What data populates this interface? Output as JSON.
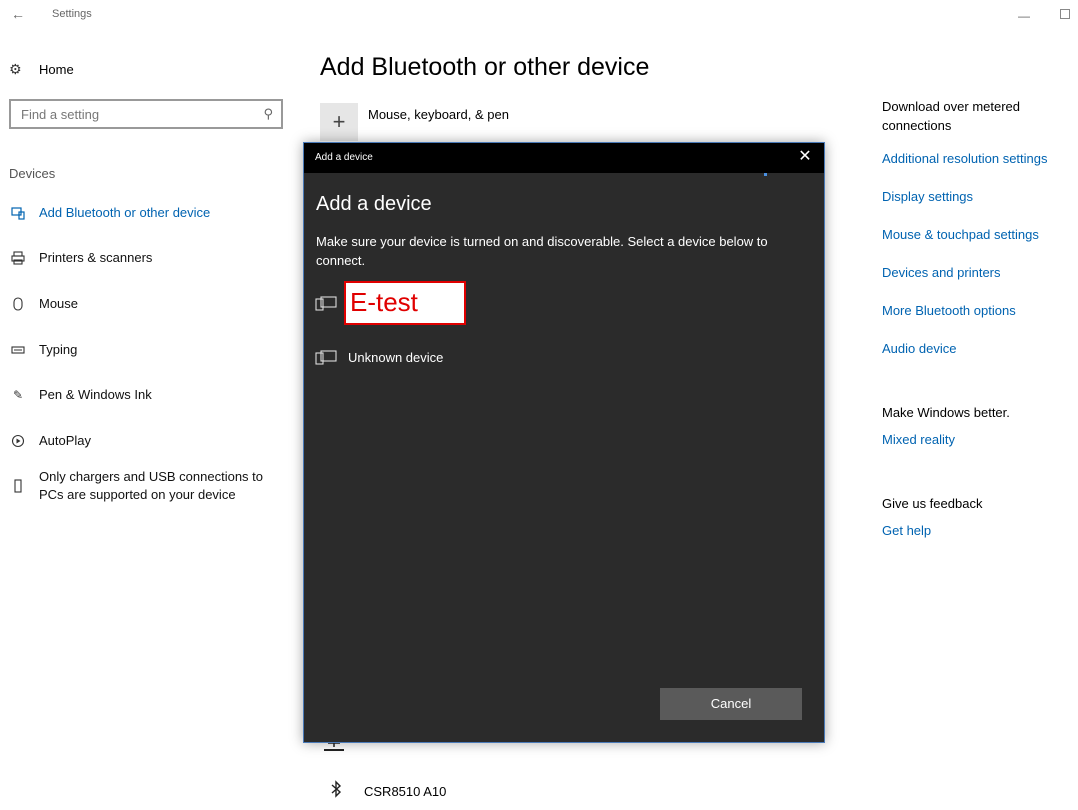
{
  "window": {
    "title": "Settings",
    "back_glyph": "←",
    "min_glyph": "—"
  },
  "sidebar": {
    "home_label": "Home",
    "search_placeholder": "Find a setting",
    "section_label": "Devices",
    "items": [
      {
        "label": "Add Bluetooth or other device",
        "icon": "bluetooth-devices-icon",
        "active": true
      },
      {
        "label": "Printers & scanners",
        "icon": "printer-icon",
        "active": false
      },
      {
        "label": "Mouse",
        "icon": "mouse-icon",
        "active": false
      },
      {
        "label": "Typing",
        "icon": "keyboard-icon",
        "active": false
      },
      {
        "label": "Pen & Windows Ink",
        "icon": "pen-icon",
        "active": false
      },
      {
        "label": "AutoPlay",
        "icon": "autoplay-icon",
        "active": false
      },
      {
        "label": "Only chargers and USB connections to PCs are supported on your device",
        "icon": "usb-icon",
        "active": false
      }
    ]
  },
  "main": {
    "title": "Add Bluetooth or other device",
    "add_row_label": "Mouse, keyboard, & pen",
    "bg_device_label": "CSR8510 A10"
  },
  "right_panel": {
    "metered": "Download over metered connections",
    "links": [
      "Additional resolution settings",
      "Display settings",
      "Mouse & touchpad settings",
      "Devices and printers",
      "More Bluetooth options",
      "Audio device"
    ],
    "make_better": "Make Windows better.",
    "mixed_reality": "Mixed reality",
    "feedback": "Give us feedback",
    "get_help": "Get help"
  },
  "dialog": {
    "window_title": "Add a device",
    "heading": "Add a device",
    "description": "Make sure your device is turned on and discoverable. Select a device below to connect.",
    "devices": [
      {
        "label": "E-test",
        "highlighted": true
      },
      {
        "label": "Unknown device",
        "highlighted": false
      }
    ],
    "cancel_label": "Cancel"
  },
  "colors": {
    "accent": "#0063b1",
    "dialog_bg": "#2b2b2b",
    "highlight": "#e00000"
  }
}
